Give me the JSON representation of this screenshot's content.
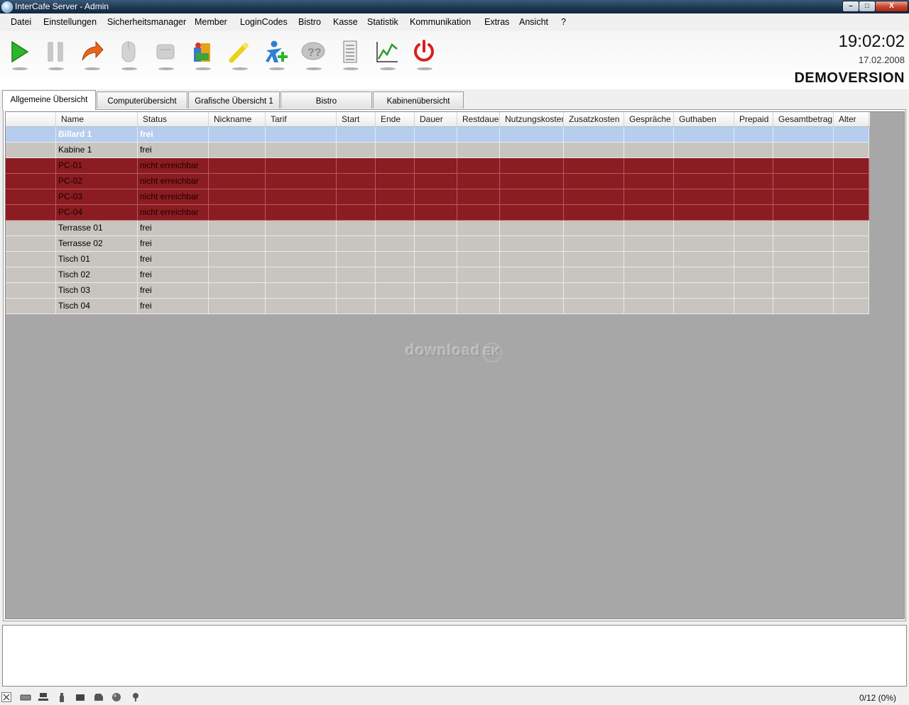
{
  "window": {
    "title": "InterCafe Server - Admin"
  },
  "menu": [
    "Datei",
    "Einstellungen",
    "Sicherheitsmanager",
    "Member",
    "LoginCodes",
    "Bistro",
    "Kasse",
    "Statistik",
    "Kommunikation",
    "Extras",
    "Ansicht",
    "?"
  ],
  "toolbar": {
    "buttons": [
      "play-icon",
      "pause-icon",
      "redirect-arrow-icon",
      "mouse-icon",
      "message-icon",
      "bistro-icon",
      "key-icon",
      "add-user-icon",
      "help-icon",
      "list-icon",
      "chart-icon",
      "power-icon"
    ],
    "colors": {
      "play": "#2bb52b",
      "arrow": "#e8661a",
      "power": "#d91f1f",
      "chart": "#2a9a2a",
      "user": "#2f7fd2"
    }
  },
  "header_info": {
    "time": "19:02:02",
    "date": "17.02.2008",
    "demo": "DEMOVERSION"
  },
  "tabs": [
    "Allgemeine Übersicht",
    "Computerübersicht",
    "Grafische Übersicht 1",
    "Bistro",
    "Kabinenübersicht"
  ],
  "active_tab": 0,
  "grid": {
    "columns": [
      "",
      "Name",
      "Status",
      "Nickname",
      "Tarif",
      "Start",
      "Ende",
      "Dauer",
      "Restdauer",
      "Nutzungskosten",
      "Zusatzkosten",
      "Gespräche",
      "Guthaben",
      "Prepaid",
      "Gesamtbetrag",
      "Alter"
    ],
    "rows": [
      {
        "name": "Billard 1",
        "status": "frei",
        "state": "sel"
      },
      {
        "name": "Kabine 1",
        "status": "frei",
        "state": "grey"
      },
      {
        "name": "PC-01",
        "status": "nicht erreichbar",
        "state": "red"
      },
      {
        "name": "PC-02",
        "status": "nicht erreichbar",
        "state": "red"
      },
      {
        "name": "PC-03",
        "status": "nicht erreichbar",
        "state": "red"
      },
      {
        "name": "PC-04",
        "status": "nicht erreichbar",
        "state": "red"
      },
      {
        "name": "Terrasse 01",
        "status": "frei",
        "state": "grey"
      },
      {
        "name": "Terrasse 02",
        "status": "frei",
        "state": "grey"
      },
      {
        "name": "Tisch 01",
        "status": "frei",
        "state": "grey"
      },
      {
        "name": "Tisch 02",
        "status": "frei",
        "state": "grey"
      },
      {
        "name": "Tisch 03",
        "status": "frei",
        "state": "grey"
      },
      {
        "name": "Tisch 04",
        "status": "frei",
        "state": "grey"
      }
    ],
    "row_colors": {
      "sel": "#b6cdee",
      "grey": "#c8c4bf",
      "red": "#8b1c22"
    }
  },
  "watermark": {
    "text": "download",
    "badge": "EK"
  },
  "statusbar": {
    "counter": "0/12 (0%)",
    "icons": [
      "close-icon",
      "keyboard-icon",
      "network-icon",
      "bottle-icon",
      "printer-icon",
      "disk-icon",
      "globe-icon",
      "webcam-icon"
    ]
  }
}
